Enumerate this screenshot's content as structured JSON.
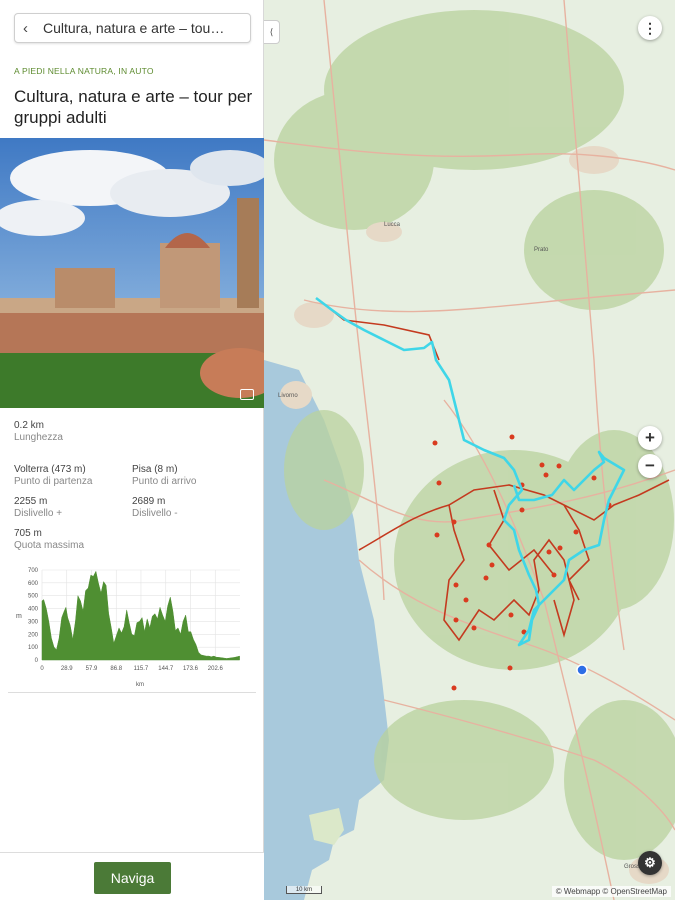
{
  "header": {
    "back_icon": "chevron-left-icon",
    "title": "Cultura, natura e arte – tou…"
  },
  "collapse_icon": "collapse-panel-icon",
  "route": {
    "category": "A PIEDI NELLA NATURA, IN AUTO",
    "title": "Cultura, natura e arte – tour per gruppi adulti"
  },
  "stats": {
    "length_value": "0.2 km",
    "length_label": "Lunghezza",
    "start_value": "Volterra (473 m)",
    "start_label": "Punto di partenza",
    "end_value": "Pisa (8 m)",
    "end_label": "Punto di arrivo",
    "ascent_value": "2255 m",
    "ascent_label": "Dislivello +",
    "descent_value": "2689 m",
    "descent_label": "Dislivello -",
    "max_value": "705 m",
    "max_label": "Quota massima"
  },
  "chart_data": {
    "type": "area",
    "title": "",
    "xlabel": "km",
    "ylabel": "m",
    "xlim": [
      0,
      231.5
    ],
    "ylim": [
      0,
      700
    ],
    "y_ticks": [
      "0",
      "100",
      "200",
      "300",
      "400",
      "500",
      "600",
      "700"
    ],
    "x_ticks": [
      "0",
      "28.9",
      "57.9",
      "86.8",
      "115.7",
      "144.7",
      "173.6",
      "202.6"
    ],
    "x": [
      0,
      2,
      5,
      8,
      11,
      14,
      17,
      20,
      23,
      26,
      28,
      30,
      33,
      36,
      39,
      42,
      45,
      48,
      51,
      54,
      57,
      60,
      63,
      66,
      69,
      72,
      75,
      78,
      81,
      84,
      87,
      90,
      93,
      96,
      99,
      102,
      105,
      108,
      111,
      114,
      117,
      120,
      123,
      126,
      129,
      132,
      135,
      138,
      141,
      144,
      147,
      150,
      153,
      156,
      159,
      162,
      165,
      168,
      171,
      174,
      177,
      180,
      183,
      186,
      189,
      192,
      195,
      198,
      201,
      204,
      207,
      210,
      213,
      216,
      219,
      222,
      225,
      228,
      231
    ],
    "values": [
      460,
      470,
      400,
      300,
      170,
      100,
      80,
      170,
      330,
      380,
      410,
      330,
      270,
      160,
      300,
      500,
      460,
      380,
      540,
      560,
      660,
      650,
      690,
      600,
      520,
      610,
      580,
      360,
      250,
      130,
      190,
      250,
      210,
      260,
      390,
      290,
      200,
      190,
      290,
      300,
      330,
      220,
      320,
      250,
      340,
      360,
      320,
      410,
      350,
      300,
      420,
      490,
      380,
      230,
      250,
      200,
      300,
      350,
      220,
      220,
      160,
      120,
      60,
      40,
      35,
      30,
      30,
      25,
      30,
      22,
      20,
      18,
      15,
      12,
      15,
      18,
      20,
      25,
      30
    ],
    "fill_color": "#4f8f32"
  },
  "map": {
    "attribution": "© Webmapp © OpenStreetMap",
    "scale": "10 km",
    "more_icon": "more-vertical-icon",
    "zoom_in": "+",
    "zoom_out": "−",
    "locate_icon": "gear-locate-icon",
    "route_color": "#3fd6e8",
    "trail_color": "#c43a1f",
    "poi_color": "#d93b1f"
  },
  "footer": {
    "navigate_label": "Naviga"
  }
}
